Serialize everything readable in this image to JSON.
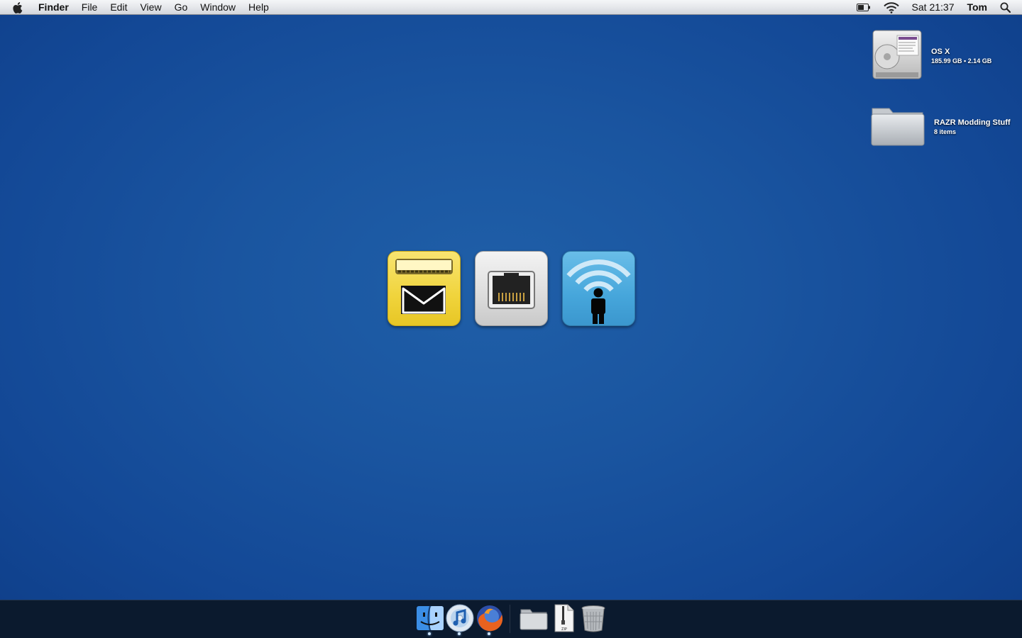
{
  "menubar": {
    "app_name": "Finder",
    "menus": [
      "File",
      "Edit",
      "View",
      "Go",
      "Window",
      "Help"
    ],
    "clock": "Sat 21:37",
    "user": "Tom",
    "status_icons": [
      "battery-icon",
      "wifi-icon",
      "spotlight-icon"
    ]
  },
  "desktop_items": [
    {
      "name": "OS X",
      "detail": "185.99 GB • 2.14 GB",
      "icon": "hard-drive-icon"
    },
    {
      "name": "RAZR Modding Stuff",
      "detail": "8 items",
      "icon": "folder-icon"
    }
  ],
  "center_icons": [
    {
      "icon": "mail-icon",
      "color": "#f0d43c"
    },
    {
      "icon": "ethernet-icon",
      "color": "#dcdcdc"
    },
    {
      "icon": "wifi-person-icon",
      "color": "#46a6db"
    }
  ],
  "dock": {
    "apps": [
      "finder-icon",
      "itunes-icon",
      "firefox-icon"
    ],
    "others": [
      "folder-icon",
      "zip-file-icon",
      "trash-icon"
    ],
    "running": [
      "finder-icon",
      "itunes-icon",
      "firefox-icon"
    ],
    "zip_label": "ZIP"
  },
  "colors": {
    "desktop": "#1a55a0",
    "dock": "#0b1a2e",
    "menubar": "#e4e6ea"
  }
}
